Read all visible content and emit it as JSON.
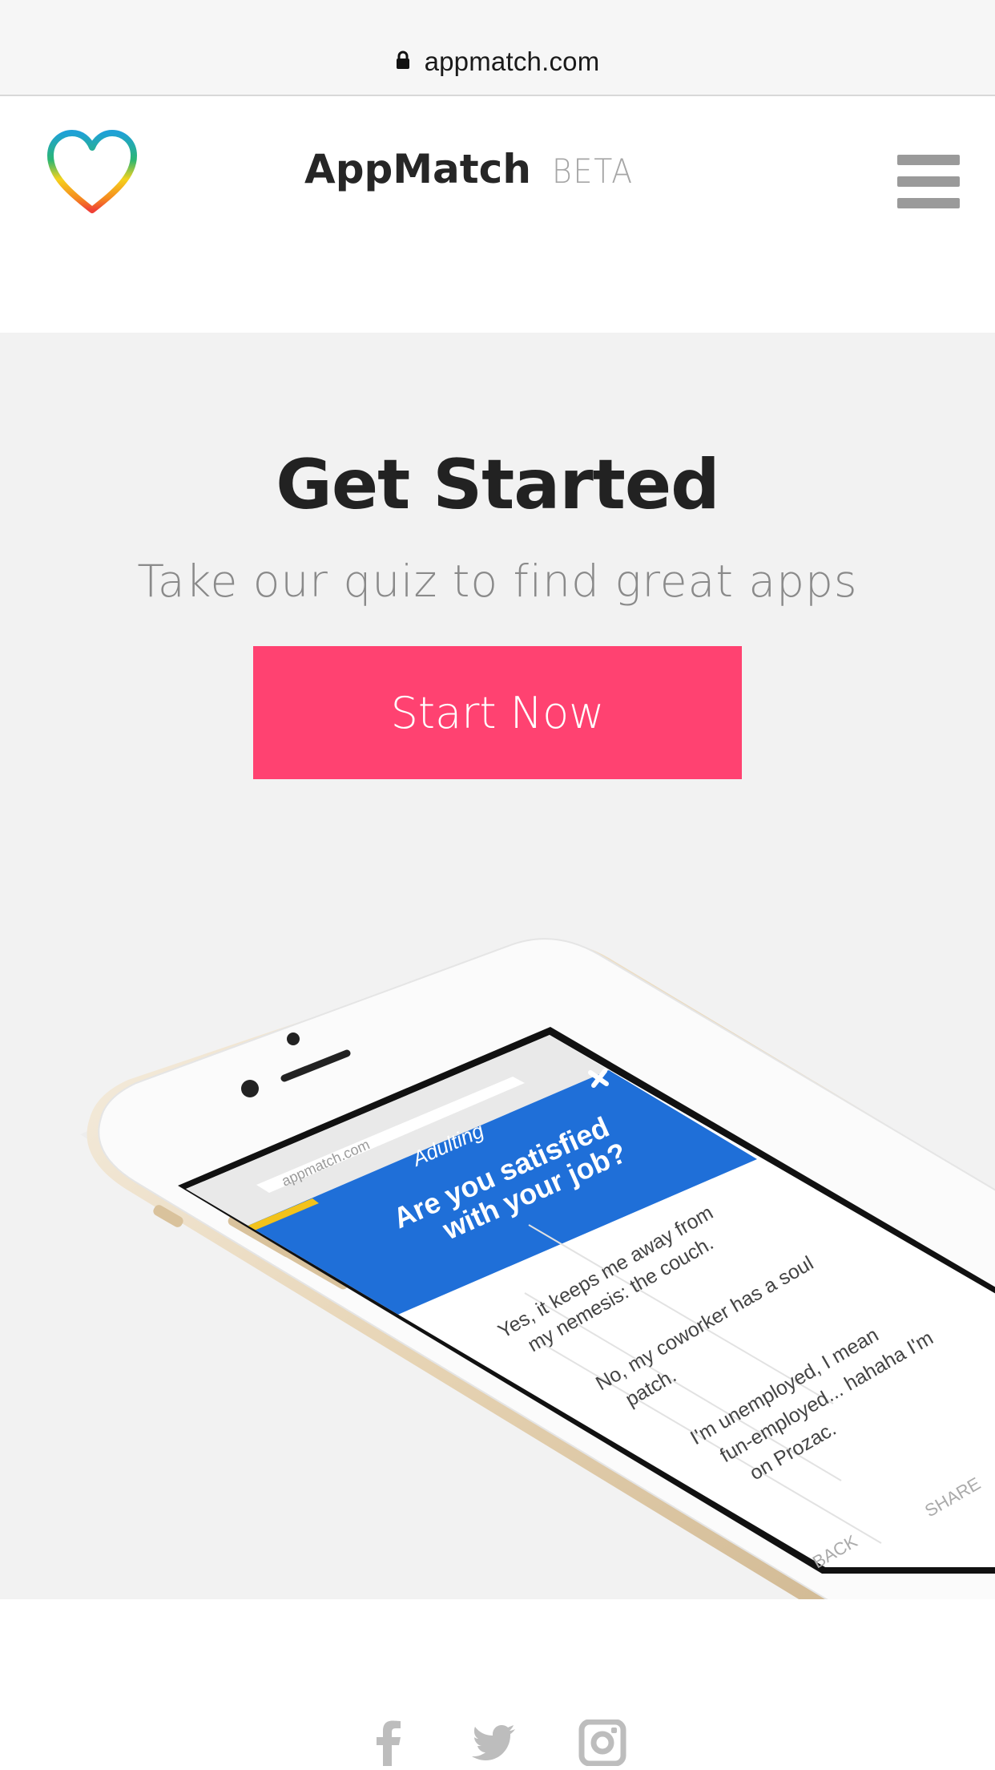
{
  "browser": {
    "url": "appmatch.com",
    "lock_icon": "lock-icon"
  },
  "header": {
    "logo_icon": "heart-icon",
    "brand_name": "AppMatch",
    "brand_tag": "BETA",
    "menu_icon": "hamburger-icon"
  },
  "hero": {
    "title": "Get Started",
    "subtitle": "Take our quiz to find great apps",
    "cta_label": "Start Now",
    "cta_color": "#ff4271"
  },
  "phone_screen": {
    "url": "appmatch.com",
    "category": "Adulting",
    "question": [
      "Are you satisfied",
      "with your job?"
    ],
    "answers": [
      [
        "Yes, it keeps me away from",
        "my nemesis: the couch."
      ],
      [
        "No, my coworker has a soul",
        "patch."
      ],
      [
        "I'm unemployed, I mean",
        "fun-employed... hahaha I'm",
        "on Prozac."
      ]
    ],
    "back_label": "BACK",
    "share_label": "SHARE",
    "accent_color": "#1f6fd8"
  },
  "footer": {
    "social": [
      "facebook-icon",
      "twitter-icon",
      "instagram-icon"
    ]
  }
}
